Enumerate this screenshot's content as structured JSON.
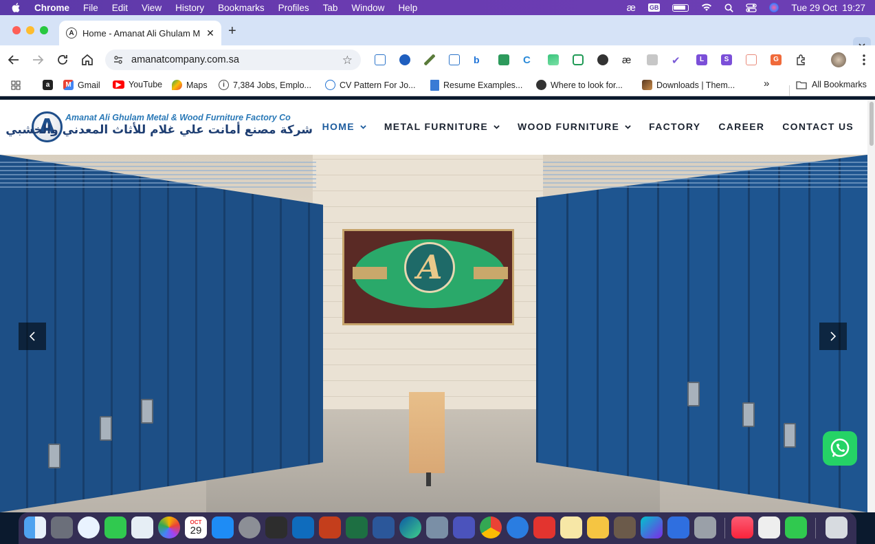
{
  "menubar": {
    "app": "Chrome",
    "items": [
      "File",
      "Edit",
      "View",
      "History",
      "Bookmarks",
      "Profiles",
      "Tab",
      "Window",
      "Help"
    ],
    "keyboard_badge": "GB",
    "datetime": "Tue 29 Oct  19:27"
  },
  "tab": {
    "title": "Home - Amanat Ali Ghulam M",
    "favicon": "A"
  },
  "toolbar": {
    "url": "amanatcompany.com.sa"
  },
  "bookmarks": {
    "items": [
      {
        "label": "",
        "icon": "amazon-icon"
      },
      {
        "label": "Gmail",
        "icon": "gmail-icon"
      },
      {
        "label": "YouTube",
        "icon": "youtube-icon"
      },
      {
        "label": "Maps",
        "icon": "maps-icon"
      },
      {
        "label": "7,384 Jobs, Emplo...",
        "icon": "info-icon"
      },
      {
        "label": "CV Pattern For Jo...",
        "icon": "globe-icon"
      },
      {
        "label": "Resume Examples...",
        "icon": "doc-icon"
      },
      {
        "label": "Where to look for...",
        "icon": "globe-icon"
      },
      {
        "label": "Downloads | Them...",
        "icon": "theme-icon"
      }
    ],
    "all_label": "All Bookmarks"
  },
  "site": {
    "logo_letter": "A",
    "company_en": "Amanat Ali Ghulam Metal & Wood Furniture Factory Co",
    "company_ar": "شركة مصنع أمانت علي غلام للأثاث المعدني والخشبي",
    "nav": [
      {
        "label": "HOME",
        "dropdown": true,
        "active": true
      },
      {
        "label": "METAL FURNITURE",
        "dropdown": true,
        "active": false
      },
      {
        "label": "WOOD FURNITURE",
        "dropdown": true,
        "active": false
      },
      {
        "label": "FACTORY",
        "dropdown": false,
        "active": false
      },
      {
        "label": "CAREER",
        "dropdown": false,
        "active": false
      },
      {
        "label": "CONTACT US",
        "dropdown": false,
        "active": false
      }
    ],
    "sign_letter": "A"
  },
  "dock": {
    "calendar_month": "OCT",
    "calendar_day": "29"
  },
  "colors": {
    "menubar": "#5b39a8",
    "tabstrip": "#d6e3f7",
    "brand_blue": "#1f4e8a",
    "nav_active": "#1d5c9e",
    "whatsapp": "#25d366"
  }
}
